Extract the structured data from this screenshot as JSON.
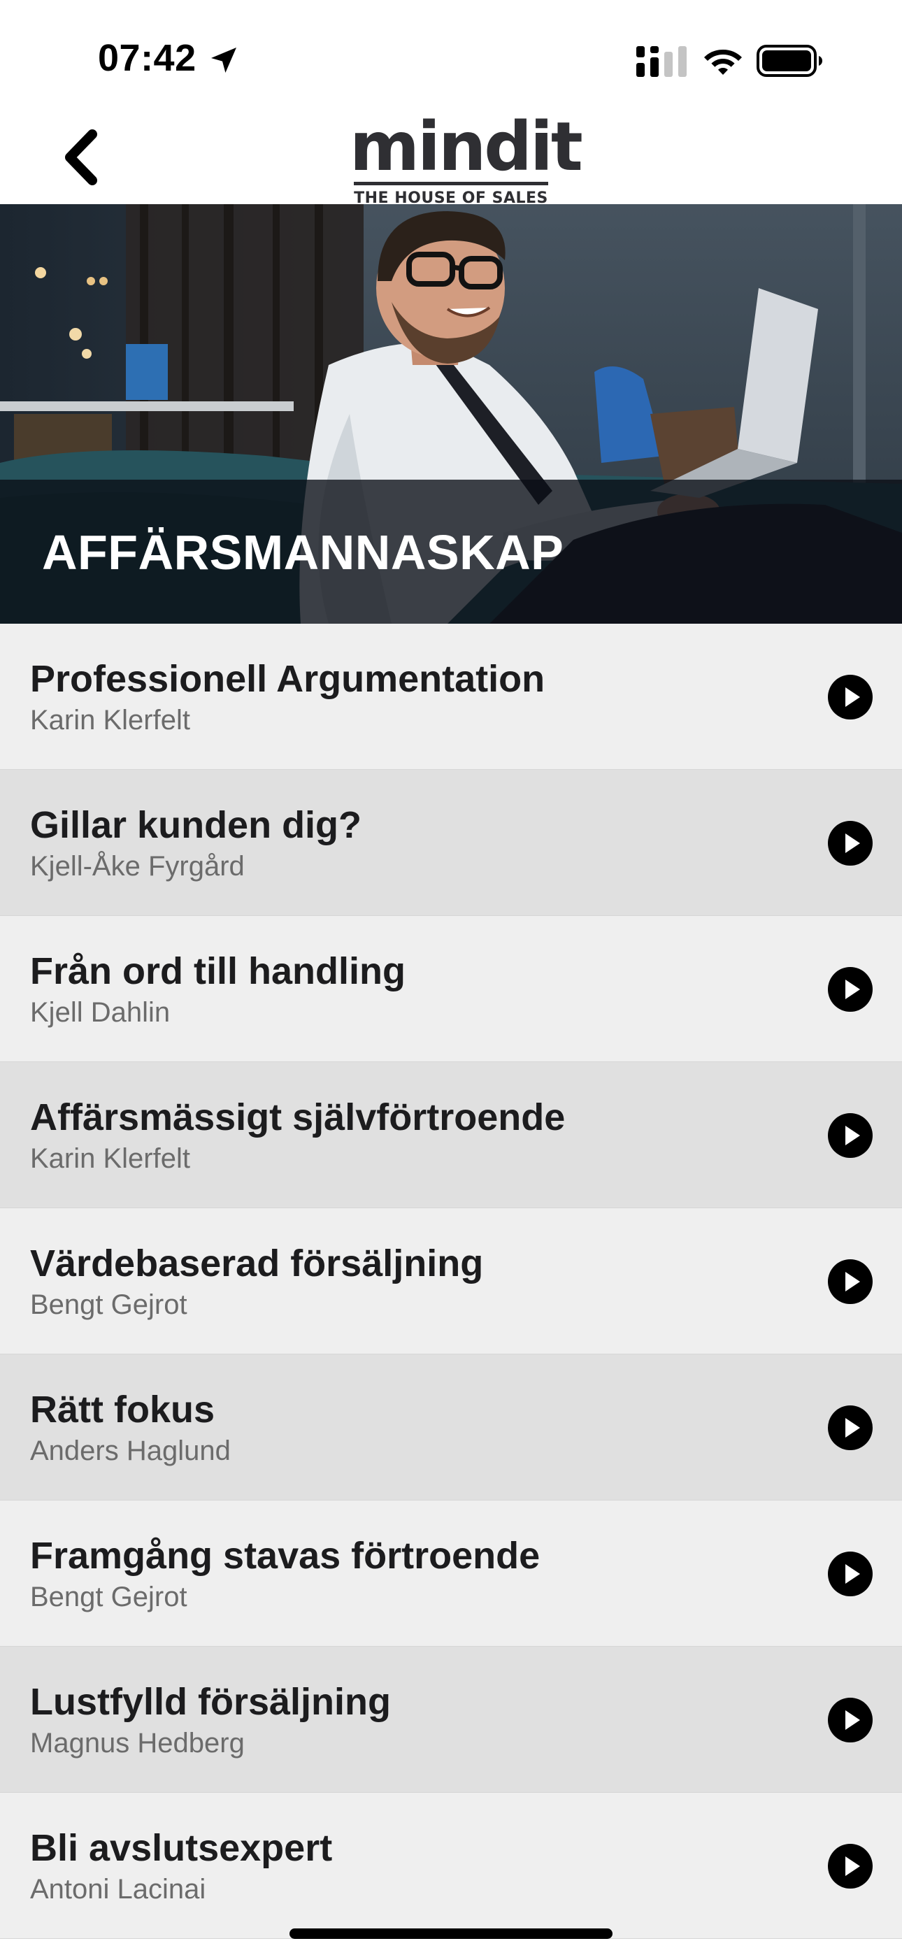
{
  "status_bar": {
    "time": "07:42",
    "icons": [
      "location-arrow-icon",
      "cellular-signal-icon",
      "wifi-icon",
      "battery-icon"
    ]
  },
  "nav": {
    "back_icon": "chevron-left-icon",
    "logo_word": "mindit",
    "logo_tagline": "THE HOUSE OF SALES"
  },
  "hero": {
    "title": "AFFÄRSMANNASKAP"
  },
  "courses": [
    {
      "title": "Professionell Argumentation",
      "author": "Karin Klerfelt"
    },
    {
      "title": "Gillar kunden dig?",
      "author": "Kjell-Åke Fyrgård"
    },
    {
      "title": "Från ord till handling",
      "author": "Kjell Dahlin"
    },
    {
      "title": "Affärsmässigt självförtroende",
      "author": "Karin Klerfelt"
    },
    {
      "title": "Värdebaserad försäljning",
      "author": "Bengt Gejrot"
    },
    {
      "title": "Rätt fokus",
      "author": "Anders Haglund"
    },
    {
      "title": "Framgång stavas förtroende",
      "author": "Bengt Gejrot"
    },
    {
      "title": "Lustfylld försäljning",
      "author": "Magnus Hedberg"
    },
    {
      "title": "Bli avslutsexpert",
      "author": "Antoni Lacinai"
    }
  ],
  "colors": {
    "row_light": "#efefef",
    "row_dark": "#e0e0e0",
    "title_text": "#1c1c1e",
    "author_text": "#6b6b6b",
    "logo": "#2f2f33"
  }
}
